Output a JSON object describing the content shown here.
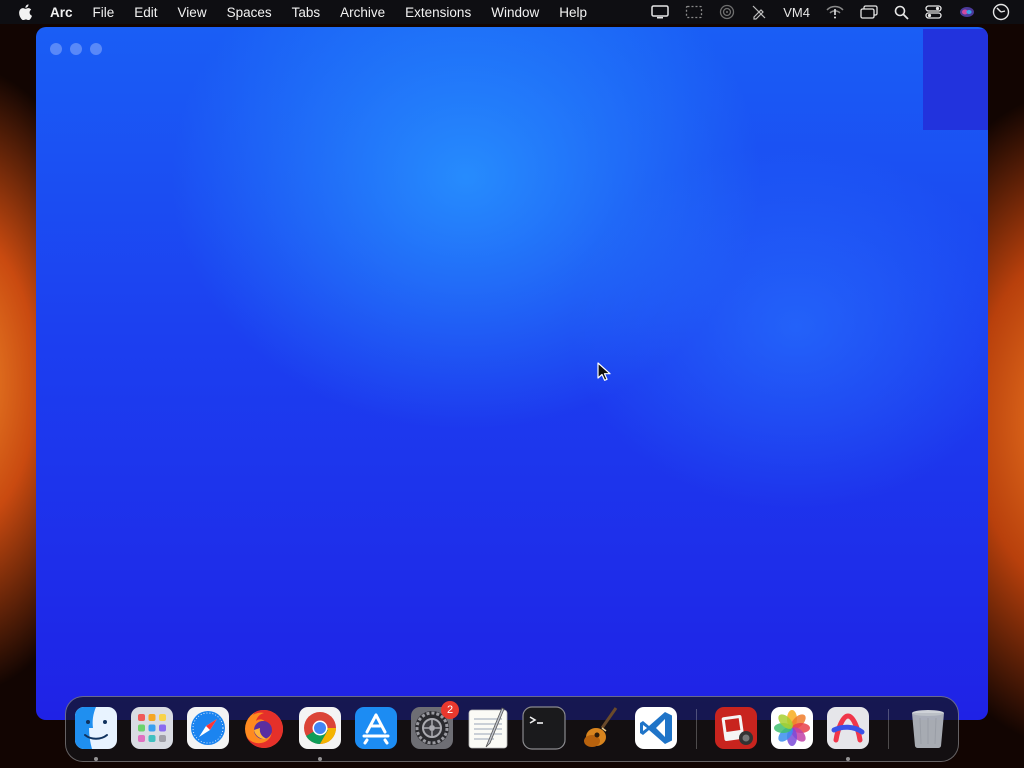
{
  "menubar": {
    "app_name": "Arc",
    "items": [
      "File",
      "Edit",
      "View",
      "Spaces",
      "Tabs",
      "Archive",
      "Extensions",
      "Window",
      "Help"
    ],
    "status": {
      "vpn_label": "VM4",
      "icons": [
        "display-icon",
        "screen-record-icon",
        "airdrop-icon",
        "pen-slash-icon",
        "wifi-icon",
        "window-stack-icon",
        "search-icon",
        "control-center-icon",
        "siri-icon",
        "clock-icon"
      ]
    }
  },
  "window": {
    "app": "Arc",
    "colors": {
      "top": "#1a5ef5",
      "bottom": "#1f22e6",
      "highlight": "#2896ff"
    }
  },
  "dock": {
    "apps": [
      {
        "name": "Finder",
        "icon": "finder-icon",
        "running": true
      },
      {
        "name": "Launchpad",
        "icon": "launchpad-icon",
        "running": false
      },
      {
        "name": "Safari",
        "icon": "safari-icon",
        "running": false
      },
      {
        "name": "Firefox",
        "icon": "firefox-icon",
        "running": false
      },
      {
        "name": "Google Chrome",
        "icon": "chrome-icon",
        "running": true
      },
      {
        "name": "App Store",
        "icon": "app-store-icon",
        "running": false
      },
      {
        "name": "System Settings",
        "icon": "settings-icon",
        "running": false,
        "badge": "2"
      },
      {
        "name": "TextEdit",
        "icon": "textedit-icon",
        "running": false
      },
      {
        "name": "Terminal",
        "icon": "terminal-icon",
        "running": false
      },
      {
        "name": "GarageBand",
        "icon": "garageband-icon",
        "running": false
      },
      {
        "name": "Visual Studio Code",
        "icon": "vscode-icon",
        "running": false
      },
      {
        "name": "Photo Booth",
        "icon": "photo-booth-icon",
        "running": false
      },
      {
        "name": "Photos",
        "icon": "photos-icon",
        "running": false
      },
      {
        "name": "Arc",
        "icon": "arc-icon",
        "running": true
      },
      {
        "name": "Trash",
        "icon": "trash-icon",
        "running": false
      }
    ]
  }
}
